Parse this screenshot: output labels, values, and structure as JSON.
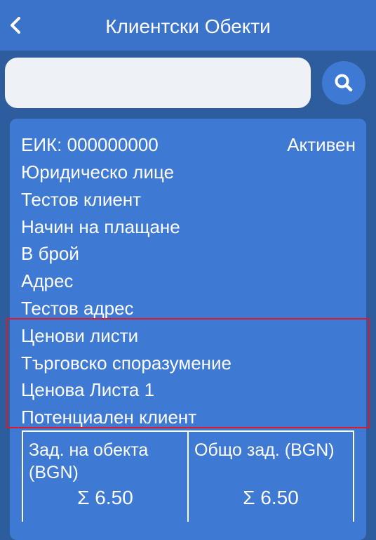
{
  "header": {
    "title": "Клиентски Обекти",
    "back_icon": "chevron-left-icon"
  },
  "search": {
    "value": "",
    "placeholder": "",
    "icon": "search-icon"
  },
  "client": {
    "eik": "ЕИК: 000000000",
    "status": "Активен",
    "entity_type": "Юридическо лице",
    "name": "Тестов клиент",
    "payment_label": "Начин на плащане",
    "payment_value": "В брой",
    "address_label": "Адрес",
    "address_value": "Тестов адрес",
    "price_lists_label": "Ценови листи",
    "agreement": "Търговско споразумение",
    "price_list": "Ценова Листа 1",
    "potential_client": "Потенциален клиент"
  },
  "debt": {
    "object_label": "Зад. на обекта (BGN)",
    "object_value": "Σ 6.50",
    "total_label": "Общо зад. (BGN)",
    "total_value": "Σ 6.50"
  },
  "colors": {
    "header_bg": "#3a73c9",
    "page_bg": "#2e5d9e",
    "card_bg": "#3e7ad4",
    "highlight_border": "#e0192a"
  }
}
